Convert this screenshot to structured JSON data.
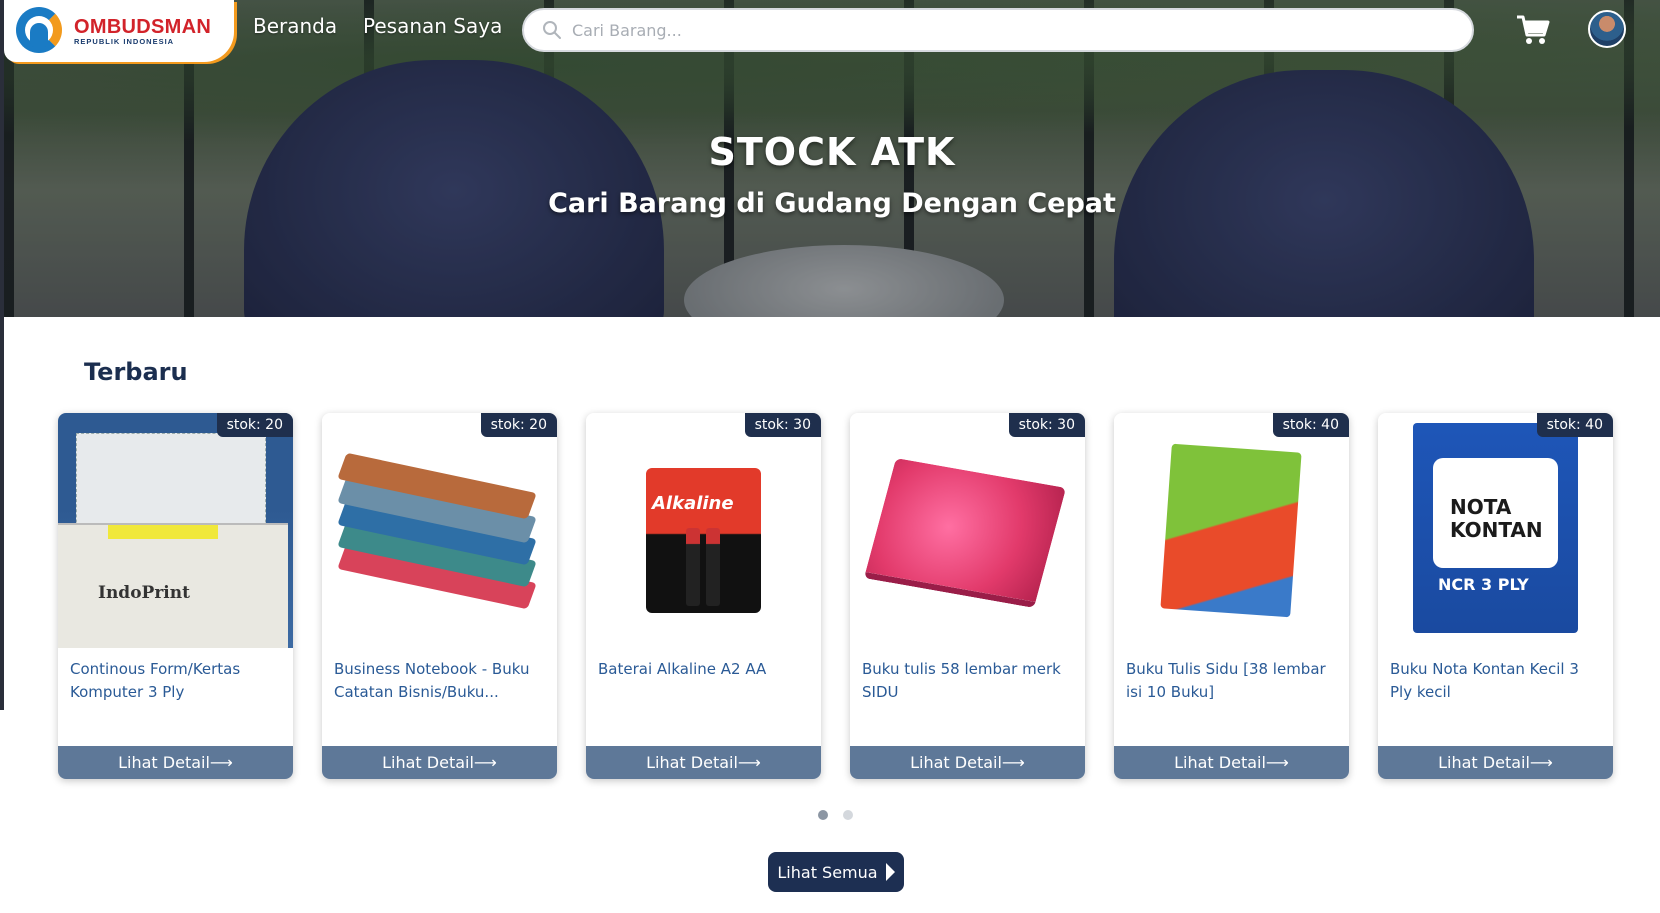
{
  "brand": {
    "name": "OMBUDSMAN",
    "sub": "REPUBLIK INDONESIA"
  },
  "nav": {
    "home": "Beranda",
    "orders": "Pesanan Saya"
  },
  "search": {
    "placeholder": "Cari Barang..."
  },
  "hero": {
    "title": "STOCK ATK",
    "subtitle": "Cari Barang di Gudang Dengan Cepat"
  },
  "section": {
    "title": "Terbaru"
  },
  "products": [
    {
      "stock": "stok: 20",
      "title": "Continous Form/Kertas Komputer 3 Ply",
      "button": "Lihat Detail⟶",
      "image_text": "IndoPrint"
    },
    {
      "stock": "stok: 20",
      "title": "Business Notebook - Buku Catatan Bisnis/Buku...",
      "button": "Lihat Detail⟶"
    },
    {
      "stock": "stok: 30",
      "title": "Baterai Alkaline A2 AA",
      "button": "Lihat Detail⟶",
      "image_text": "Alkaline"
    },
    {
      "stock": "stok: 30",
      "title": "Buku tulis 58 lembar merk SIDU",
      "button": "Lihat Detail⟶"
    },
    {
      "stock": "stok: 40",
      "title": "Buku Tulis Sidu [38 lembar isi 10 Buku]",
      "button": "Lihat Detail⟶"
    },
    {
      "stock": "stok: 40",
      "title": "Buku Nota Kontan Kecil 3 Ply kecil",
      "button": "Lihat Detail⟶",
      "image_text_1": "NOTA",
      "image_text_2": "KONTAN",
      "image_text_3": "NCR 3 PLY"
    }
  ],
  "pager": {
    "pages": 2,
    "active": 1
  },
  "see_all": {
    "label": "Lihat Semua"
  },
  "colors": {
    "navy": "#1d2f52",
    "button": "#5e7898",
    "title_blue": "#2a5a96",
    "accent_orange": "#f39a1e"
  },
  "icons": {
    "search": "search-icon",
    "cart": "cart-icon",
    "avatar": "user-avatar"
  }
}
